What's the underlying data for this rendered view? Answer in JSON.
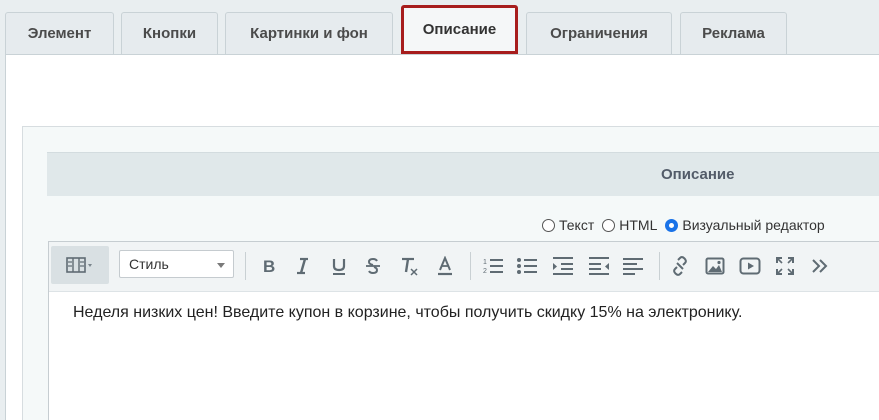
{
  "tabs": [
    {
      "label": "Элемент",
      "active": false
    },
    {
      "label": "Кнопки",
      "active": false
    },
    {
      "label": "Картинки и фон",
      "active": false
    },
    {
      "label": "Описание",
      "active": true
    },
    {
      "label": "Ограничения",
      "active": false
    },
    {
      "label": "Реклама",
      "active": false
    }
  ],
  "section": {
    "title": "Описание"
  },
  "modes": {
    "text": "Текст",
    "html": "HTML",
    "visual": "Визуальный редактор",
    "selected": "visual"
  },
  "toolbar": {
    "style_select": "Стиль",
    "icons": [
      "mode-switch-icon",
      "bold-icon",
      "italic-icon",
      "underline-icon",
      "strikethrough-icon",
      "clear-format-icon",
      "font-color-icon",
      "ordered-list-icon",
      "unordered-list-icon",
      "indent-icon",
      "outdent-icon",
      "align-left-icon",
      "link-icon",
      "image-icon",
      "video-icon",
      "fullscreen-icon",
      "more-icon"
    ]
  },
  "editor": {
    "content": "Неделя низких цен! Введите купон в корзине, чтобы получить скидку 15% на электронику."
  },
  "colors": {
    "active_tab_border": "#a71d1d",
    "radio_checked": "#1a73e8"
  }
}
